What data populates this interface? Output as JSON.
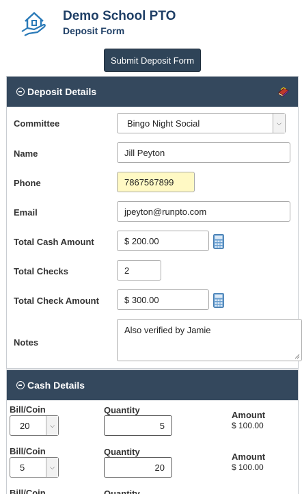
{
  "header": {
    "org_name": "Demo School PTO",
    "form_name": "Deposit Form",
    "logo_icon": "house-hand-icon"
  },
  "submit_label": "Submit Deposit Form",
  "deposit_details": {
    "title": "Deposit Details",
    "committee_label": "Committee",
    "committee_value": "Bingo Night Social",
    "name_label": "Name",
    "name_value": "Jill Peyton",
    "phone_label": "Phone",
    "phone_value": "7867567899",
    "email_label": "Email",
    "email_value": "jpeyton@runpto.com",
    "total_cash_label": "Total Cash Amount",
    "total_cash_value": "$ 200.00",
    "total_checks_label": "Total Checks",
    "total_checks_value": "2",
    "total_check_amount_label": "Total Check Amount",
    "total_check_amount_value": "$ 300.00",
    "notes_label": "Notes",
    "notes_value": "Also verified by Jamie"
  },
  "cash_details": {
    "title": "Cash Details",
    "rows": [
      {
        "bill_label": "Bill/Coin",
        "bill_value": "20",
        "qty_label": "Quantity",
        "qty_value": "5",
        "amount_label": "Amount",
        "amount_value": "$ 100.00"
      },
      {
        "bill_label": "Bill/Coin",
        "bill_value": "5",
        "qty_label": "Quantity",
        "qty_value": "20",
        "amount_label": "Amount",
        "amount_value": "$ 100.00"
      },
      {
        "bill_label": "Bill/Coin",
        "qty_label": "Quantity"
      }
    ]
  },
  "colors": {
    "panel_header": "#34485d",
    "title_text": "#1f3f66",
    "phone_highlight": "#fff9c4",
    "calculator_icon": "#6a9fd0"
  }
}
